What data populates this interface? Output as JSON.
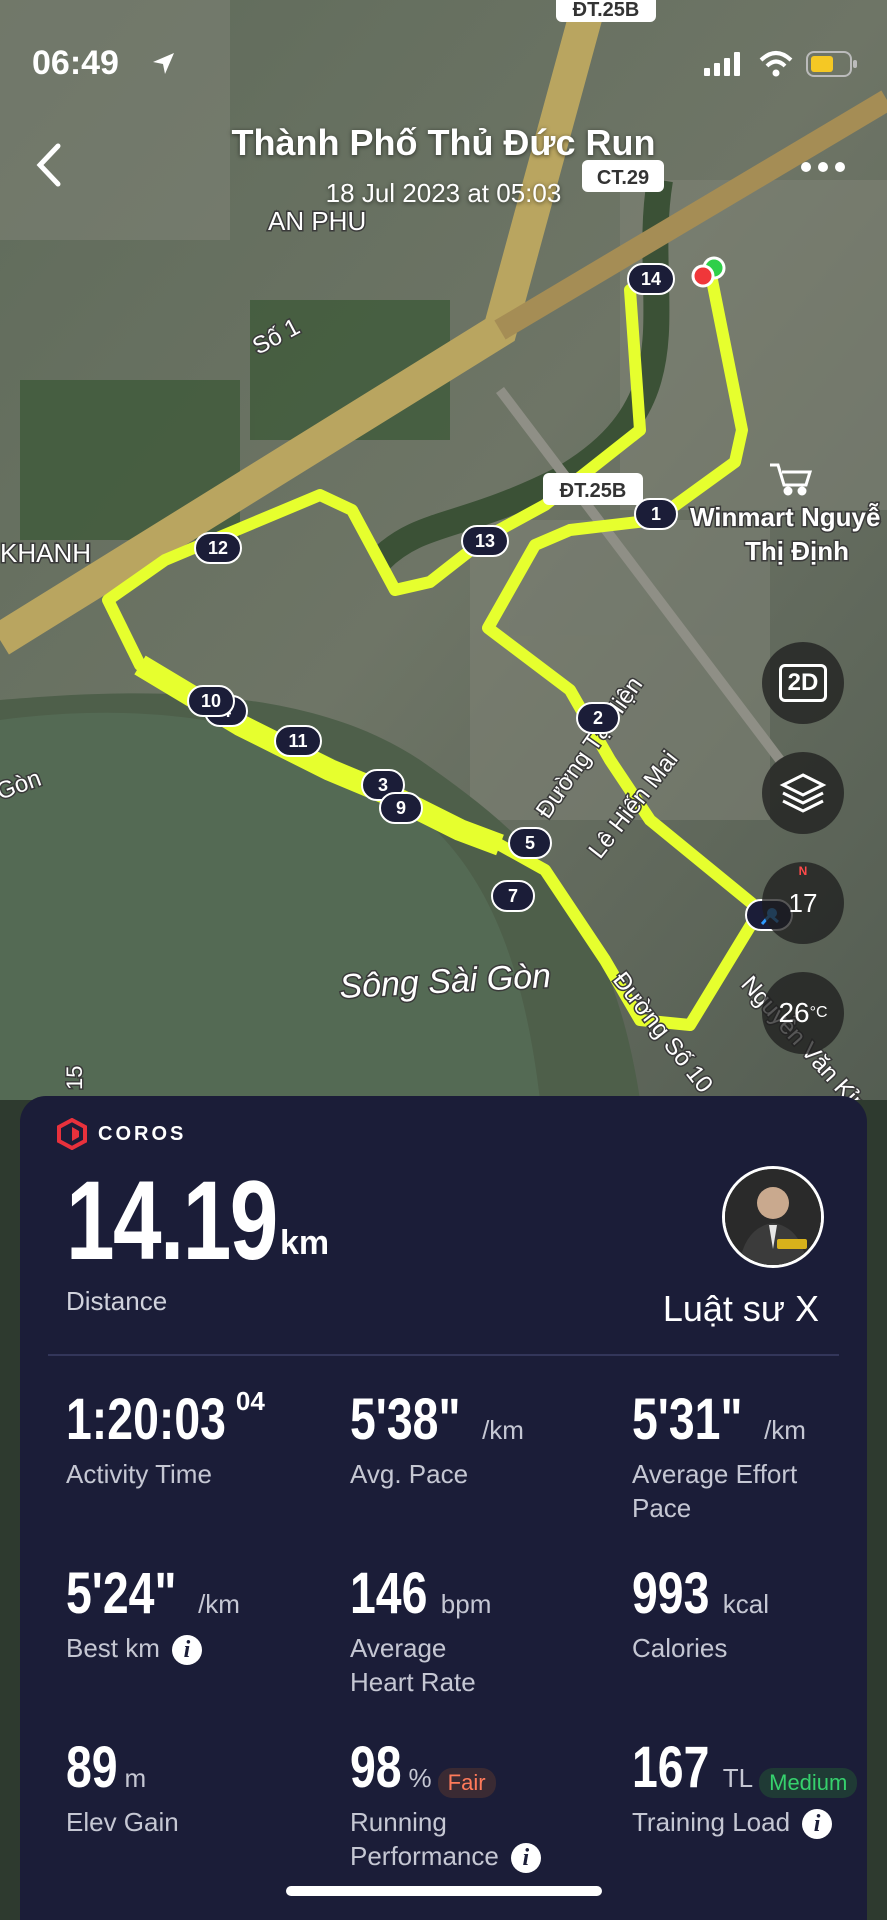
{
  "status": {
    "time": "06:49"
  },
  "header": {
    "title": "Thành Phố Thủ Đức Run",
    "subtitle": "18 Jul 2023 at 05:03"
  },
  "map": {
    "labels": [
      "ĐT.25B",
      "CT.29",
      "AN PHU",
      "Số 1",
      "KHANH",
      "ĐT.25B",
      "Winmart Nguyễ",
      "Thị Định",
      "Đường Tạ Hiện",
      "Lê Hiến Mai",
      "Sông Sài Gòn",
      "Đường Số 10",
      "Nguyễn Văn Kỉnh",
      "Gòn",
      "15"
    ],
    "markers": [
      "14",
      "1",
      "13",
      "12",
      "2",
      "10",
      "4",
      "11",
      "3",
      "9",
      "5",
      "7"
    ],
    "controls": {
      "view_mode": "2D",
      "heading": "17",
      "temperature": "26",
      "temperature_unit": "°C",
      "compass_n": "N"
    }
  },
  "panel": {
    "brand": "COROS",
    "distance": {
      "value": "14.19",
      "unit": "km",
      "label": "Distance"
    },
    "user": "Luật sư X",
    "stats": [
      {
        "value": "1:20:03",
        "sup": "04",
        "unit": "",
        "label": "Activity Time"
      },
      {
        "value": "5'38\"",
        "unit": "/km",
        "label": "Avg. Pace"
      },
      {
        "value": "5'31\"",
        "unit": "/km",
        "label": "Average Effort Pace"
      },
      {
        "value": "5'24\"",
        "unit": "/km",
        "label": "Best km"
      },
      {
        "value": "146",
        "unit": "bpm",
        "label": "Average Heart Rate"
      },
      {
        "value": "993",
        "unit": "kcal",
        "label": "Calories"
      },
      {
        "value": "89",
        "unit": "m",
        "label": "Elev Gain"
      },
      {
        "value": "98",
        "unit": "%",
        "label": "Running Performance",
        "badge": "Fair"
      },
      {
        "value": "167",
        "unit": "TL",
        "label": "Training Load",
        "badge": "Medium"
      }
    ]
  },
  "colors": {
    "route": "#e6ff2e",
    "panel_bg": "#1b1d38",
    "fair": "#ff7a5a",
    "medium": "#36d16d",
    "brand": "#e8313c"
  }
}
